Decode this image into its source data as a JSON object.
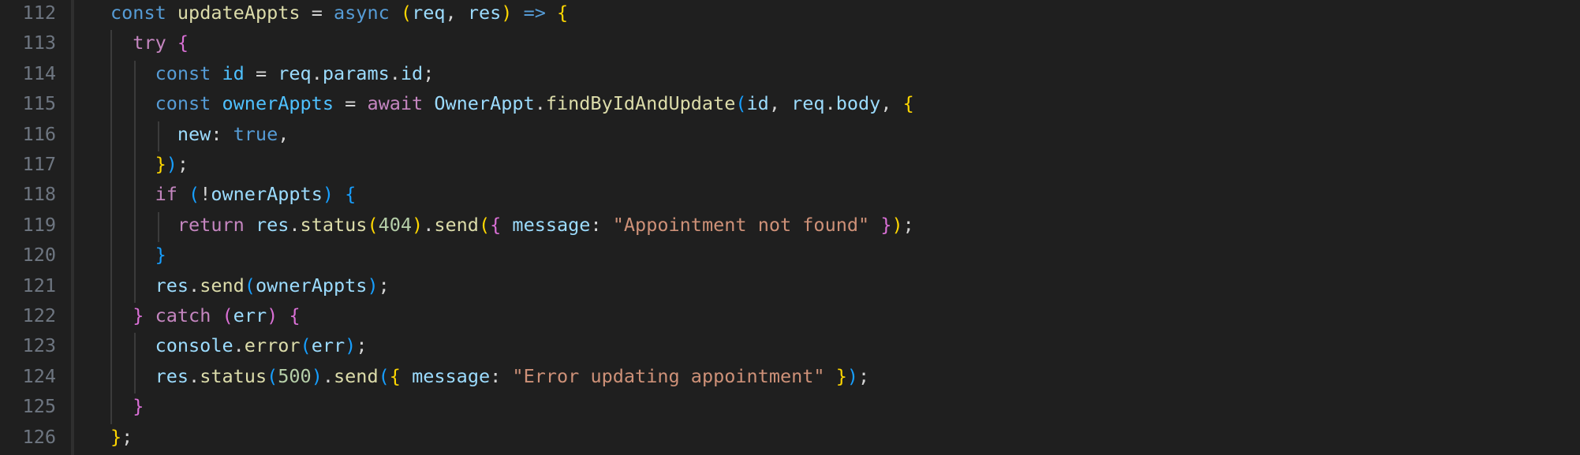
{
  "editor": {
    "line_numbers": [
      "112",
      "113",
      "114",
      "115",
      "116",
      "117",
      "118",
      "119",
      "120",
      "121",
      "122",
      "123",
      "124",
      "125",
      "126"
    ],
    "lines": [
      [
        [
          "t-kw",
          "const"
        ],
        [
          "t-p",
          " "
        ],
        [
          "t-fn",
          "updateAppts"
        ],
        [
          "t-p",
          " = "
        ],
        [
          "t-kw",
          "async"
        ],
        [
          "t-p",
          " "
        ],
        [
          "b1",
          "("
        ],
        [
          "t-var",
          "req"
        ],
        [
          "t-p",
          ", "
        ],
        [
          "t-var",
          "res"
        ],
        [
          "b1",
          ")"
        ],
        [
          "t-p",
          " "
        ],
        [
          "t-kw",
          "=>"
        ],
        [
          "t-p",
          " "
        ],
        [
          "b1",
          "{"
        ]
      ],
      [
        [
          "t-p",
          "  "
        ],
        [
          "t-ctl",
          "try"
        ],
        [
          "t-p",
          " "
        ],
        [
          "b2",
          "{"
        ]
      ],
      [
        [
          "t-p",
          "    "
        ],
        [
          "t-kw",
          "const"
        ],
        [
          "t-p",
          " "
        ],
        [
          "t-const",
          "id"
        ],
        [
          "t-p",
          " = "
        ],
        [
          "t-var",
          "req"
        ],
        [
          "t-p",
          "."
        ],
        [
          "t-var",
          "params"
        ],
        [
          "t-p",
          "."
        ],
        [
          "t-var",
          "id"
        ],
        [
          "t-p",
          ";"
        ]
      ],
      [
        [
          "t-p",
          "    "
        ],
        [
          "t-kw",
          "const"
        ],
        [
          "t-p",
          " "
        ],
        [
          "t-const",
          "ownerAppts"
        ],
        [
          "t-p",
          " = "
        ],
        [
          "t-ctl",
          "await"
        ],
        [
          "t-p",
          " "
        ],
        [
          "t-var",
          "OwnerAppt"
        ],
        [
          "t-p",
          "."
        ],
        [
          "t-fn",
          "findByIdAndUpdate"
        ],
        [
          "b3",
          "("
        ],
        [
          "t-var",
          "id"
        ],
        [
          "t-p",
          ", "
        ],
        [
          "t-var",
          "req"
        ],
        [
          "t-p",
          "."
        ],
        [
          "t-var",
          "body"
        ],
        [
          "t-p",
          ", "
        ],
        [
          "b1",
          "{"
        ]
      ],
      [
        [
          "t-p",
          "      "
        ],
        [
          "t-var",
          "new"
        ],
        [
          "t-p",
          ": "
        ],
        [
          "t-kw",
          "true"
        ],
        [
          "t-p",
          ","
        ]
      ],
      [
        [
          "t-p",
          "    "
        ],
        [
          "b1",
          "}"
        ],
        [
          "b3",
          ")"
        ],
        [
          "t-p",
          ";"
        ]
      ],
      [
        [
          "t-p",
          "    "
        ],
        [
          "t-ctl",
          "if"
        ],
        [
          "t-p",
          " "
        ],
        [
          "b3",
          "("
        ],
        [
          "t-p",
          "!"
        ],
        [
          "t-var",
          "ownerAppts"
        ],
        [
          "b3",
          ")"
        ],
        [
          "t-p",
          " "
        ],
        [
          "b3",
          "{"
        ]
      ],
      [
        [
          "t-p",
          "      "
        ],
        [
          "t-ctl",
          "return"
        ],
        [
          "t-p",
          " "
        ],
        [
          "t-var",
          "res"
        ],
        [
          "t-p",
          "."
        ],
        [
          "t-fn",
          "status"
        ],
        [
          "b1",
          "("
        ],
        [
          "t-num",
          "404"
        ],
        [
          "b1",
          ")"
        ],
        [
          "t-p",
          "."
        ],
        [
          "t-fn",
          "send"
        ],
        [
          "b1",
          "("
        ],
        [
          "b2",
          "{"
        ],
        [
          "t-p",
          " "
        ],
        [
          "t-var",
          "message"
        ],
        [
          "t-p",
          ": "
        ],
        [
          "t-str",
          "\"Appointment not found\""
        ],
        [
          "t-p",
          " "
        ],
        [
          "b2",
          "}"
        ],
        [
          "b1",
          ")"
        ],
        [
          "t-p",
          ";"
        ]
      ],
      [
        [
          "t-p",
          "    "
        ],
        [
          "b3",
          "}"
        ]
      ],
      [
        [
          "t-p",
          "    "
        ],
        [
          "t-var",
          "res"
        ],
        [
          "t-p",
          "."
        ],
        [
          "t-fn",
          "send"
        ],
        [
          "b3",
          "("
        ],
        [
          "t-var",
          "ownerAppts"
        ],
        [
          "b3",
          ")"
        ],
        [
          "t-p",
          ";"
        ]
      ],
      [
        [
          "t-p",
          "  "
        ],
        [
          "b2",
          "}"
        ],
        [
          "t-p",
          " "
        ],
        [
          "t-ctl",
          "catch"
        ],
        [
          "t-p",
          " "
        ],
        [
          "b2",
          "("
        ],
        [
          "t-var",
          "err"
        ],
        [
          "b2",
          ")"
        ],
        [
          "t-p",
          " "
        ],
        [
          "b2",
          "{"
        ]
      ],
      [
        [
          "t-p",
          "    "
        ],
        [
          "t-var",
          "console"
        ],
        [
          "t-p",
          "."
        ],
        [
          "t-fn",
          "error"
        ],
        [
          "b3",
          "("
        ],
        [
          "t-var",
          "err"
        ],
        [
          "b3",
          ")"
        ],
        [
          "t-p",
          ";"
        ]
      ],
      [
        [
          "t-p",
          "    "
        ],
        [
          "t-var",
          "res"
        ],
        [
          "t-p",
          "."
        ],
        [
          "t-fn",
          "status"
        ],
        [
          "b3",
          "("
        ],
        [
          "t-num",
          "500"
        ],
        [
          "b3",
          ")"
        ],
        [
          "t-p",
          "."
        ],
        [
          "t-fn",
          "send"
        ],
        [
          "b3",
          "("
        ],
        [
          "b1",
          "{"
        ],
        [
          "t-p",
          " "
        ],
        [
          "t-var",
          "message"
        ],
        [
          "t-p",
          ": "
        ],
        [
          "t-str",
          "\"Error updating appointment\""
        ],
        [
          "t-p",
          " "
        ],
        [
          "b1",
          "}"
        ],
        [
          "b3",
          ")"
        ],
        [
          "t-p",
          ";"
        ]
      ],
      [
        [
          "t-p",
          "  "
        ],
        [
          "b2",
          "}"
        ]
      ],
      [
        [
          "b1",
          "}"
        ],
        [
          "t-p",
          ";"
        ]
      ]
    ]
  }
}
